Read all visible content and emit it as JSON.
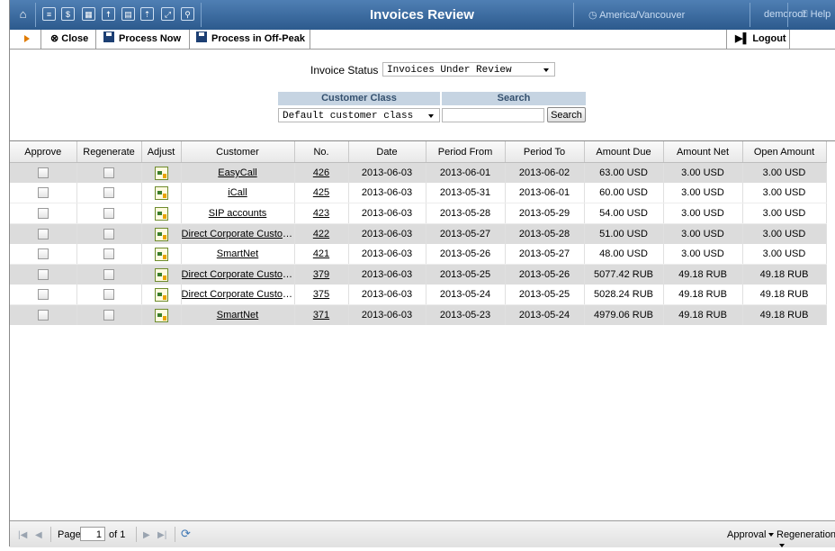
{
  "header": {
    "title": "Invoices Review",
    "timezone": "America/Vancouver",
    "user": "demoroot",
    "help": "Help"
  },
  "toolbar": {
    "close": "Close",
    "process_now": "Process Now",
    "process_offpeak": "Process in Off-Peak",
    "logout": "Logout"
  },
  "filters": {
    "invoice_status_label": "Invoice Status",
    "invoice_status_value": "Invoices Under Review",
    "customer_class_header": "Customer Class",
    "search_header": "Search",
    "customer_class_value": "Default customer class",
    "search_value": "",
    "search_button": "Search"
  },
  "table": {
    "columns": [
      "Approve",
      "Regenerate",
      "Adjust",
      "Customer",
      "No.",
      "Date",
      "Period From",
      "Period To",
      "Amount Due",
      "Amount Net",
      "Open Amount"
    ],
    "rows": [
      {
        "customer": "EasyCall",
        "no": "426",
        "date": "2013-06-03",
        "from": "2013-06-01",
        "to": "2013-06-02",
        "due": "63.00 USD",
        "net": "3.00 USD",
        "open": "3.00 USD"
      },
      {
        "customer": "iCall",
        "no": "425",
        "date": "2013-06-03",
        "from": "2013-05-31",
        "to": "2013-06-01",
        "due": "60.00 USD",
        "net": "3.00 USD",
        "open": "3.00 USD"
      },
      {
        "customer": "SIP accounts",
        "no": "423",
        "date": "2013-06-03",
        "from": "2013-05-28",
        "to": "2013-05-29",
        "due": "54.00 USD",
        "net": "3.00 USD",
        "open": "3.00 USD"
      },
      {
        "customer": "Direct Corporate Custom...",
        "no": "422",
        "date": "2013-06-03",
        "from": "2013-05-27",
        "to": "2013-05-28",
        "due": "51.00 USD",
        "net": "3.00 USD",
        "open": "3.00 USD"
      },
      {
        "customer": "SmartNet",
        "no": "421",
        "date": "2013-06-03",
        "from": "2013-05-26",
        "to": "2013-05-27",
        "due": "48.00 USD",
        "net": "3.00 USD",
        "open": "3.00 USD"
      },
      {
        "customer": "Direct Corporate Customer",
        "no": "379",
        "date": "2013-06-03",
        "from": "2013-05-25",
        "to": "2013-05-26",
        "due": "5077.42 RUB",
        "net": "49.18 RUB",
        "open": "49.18 RUB"
      },
      {
        "customer": "Direct Corporate Customer",
        "no": "375",
        "date": "2013-06-03",
        "from": "2013-05-24",
        "to": "2013-05-25",
        "due": "5028.24 RUB",
        "net": "49.18 RUB",
        "open": "49.18 RUB"
      },
      {
        "customer": "SmartNet",
        "no": "371",
        "date": "2013-06-03",
        "from": "2013-05-23",
        "to": "2013-05-24",
        "due": "4979.06 RUB",
        "net": "49.18 RUB",
        "open": "49.18 RUB"
      }
    ]
  },
  "pager": {
    "page_label": "Page",
    "page_value": "1",
    "of_label": "of 1",
    "approval_menu": "Approval",
    "regeneration_menu": "Regeneration"
  }
}
